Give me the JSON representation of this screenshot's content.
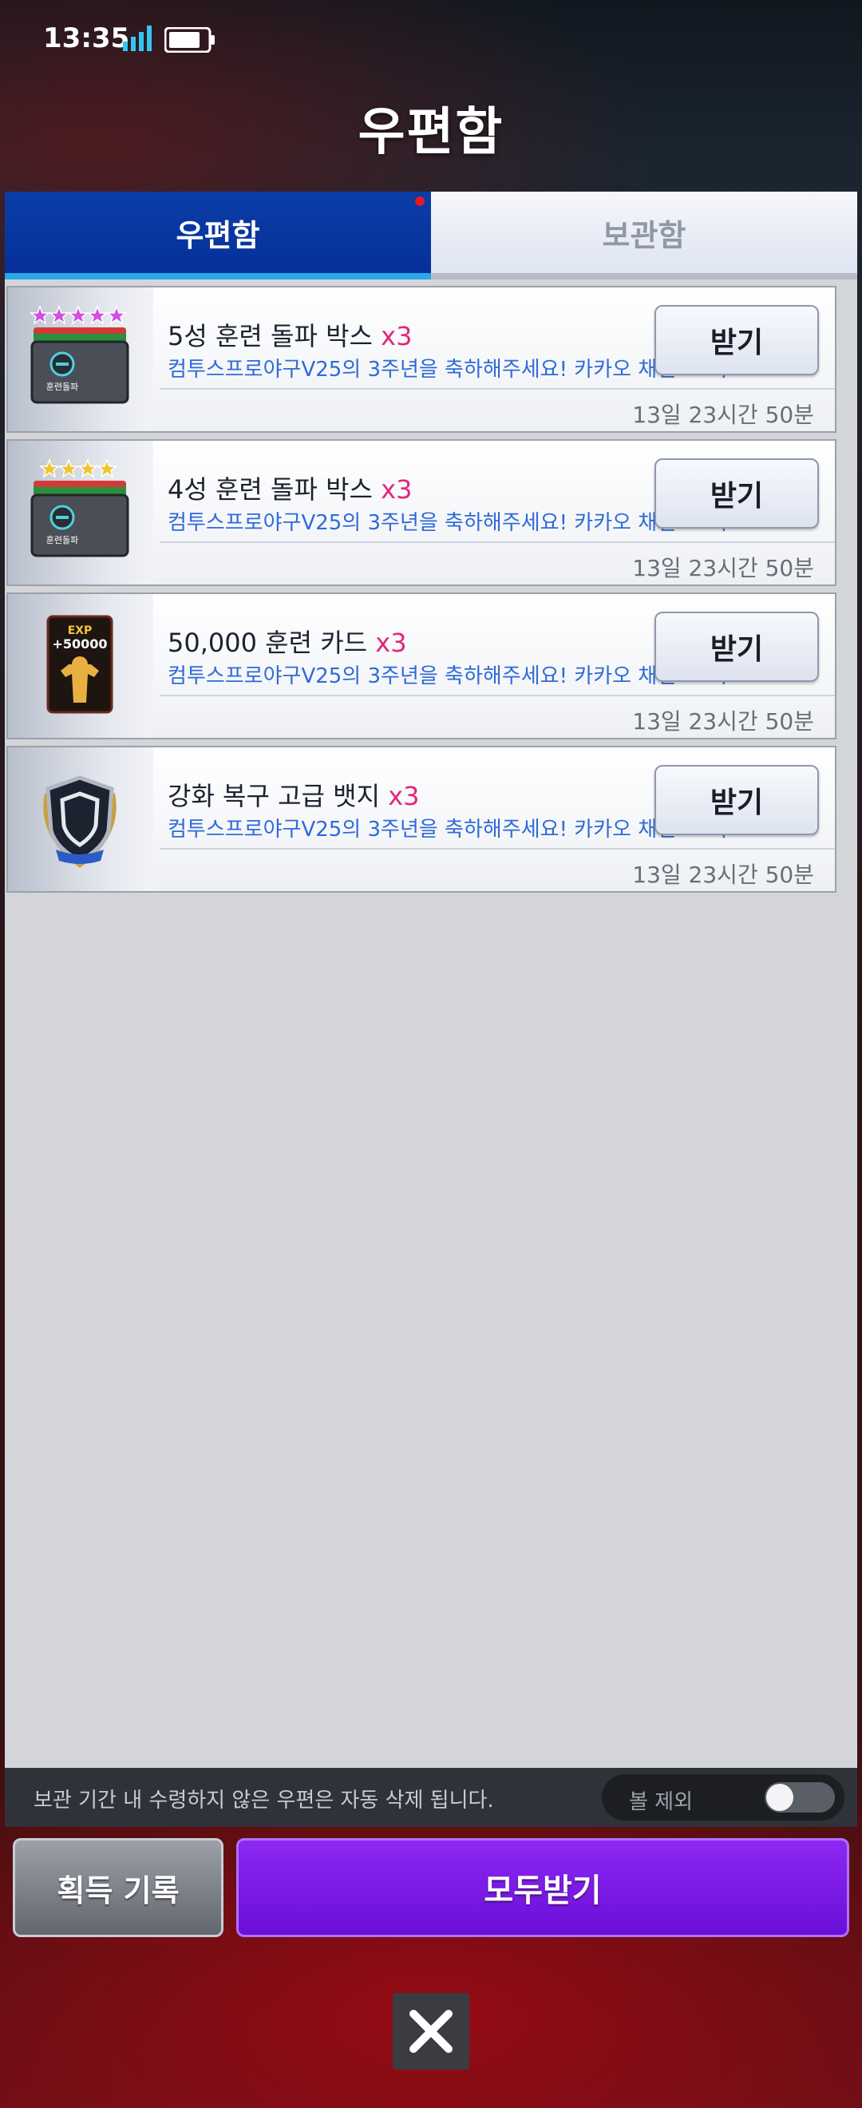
{
  "status_bar": {
    "time": "13:35"
  },
  "header": {
    "title": "우편함"
  },
  "tabs": [
    {
      "label": "우편함",
      "active": true
    },
    {
      "label": "보관함",
      "active": false
    }
  ],
  "mails": [
    {
      "title": "5성 훈련 돌파 박스",
      "qty": "x3",
      "desc": "컴투스프로야구V25의 3주년을 축하해주세요! 카카오 채널 ··· 다",
      "time": "13일 23시간 50분",
      "button": "받기",
      "icon": "training-box-5star-icon"
    },
    {
      "title": "4성 훈련 돌파 박스",
      "qty": "x3",
      "desc": "컴투스프로야구V25의 3주년을 축하해주세요! 카카오 채널 ··· 다",
      "time": "13일 23시간 50분",
      "button": "받기",
      "icon": "training-box-4star-icon"
    },
    {
      "title": "50,000 훈련 카드",
      "qty": "x3",
      "desc": "컴투스프로야구V25의 3주년을 축하해주세요! 카카오 채널 ··· 다",
      "time": "13일 23시간 50분",
      "button": "받기",
      "icon": "exp-card-icon",
      "icon_text": [
        "EXP",
        "+50000"
      ]
    },
    {
      "title": "강화 복구 고급 뱃지",
      "qty": "x3",
      "desc": "컴투스프로야구V25의 3주년을 축하해주세요! 카카오 채널 ··· 다",
      "time": "13일 23시간 50분",
      "button": "받기",
      "icon": "shield-badge-icon"
    }
  ],
  "box_label": "훈련돌파",
  "footer": {
    "notice": "보관 기간 내 수령하지 않은 우편은 자동 삭제 됩니다.",
    "filter_label": "볼 제외",
    "filter_on": false
  },
  "actions": {
    "history": "획득 기록",
    "receive_all": "모두받기"
  },
  "colors": {
    "tab_active": "#06309a",
    "qty": "#e0277a",
    "desc": "#2f6ad8",
    "receive_all": "#7a1de6"
  }
}
